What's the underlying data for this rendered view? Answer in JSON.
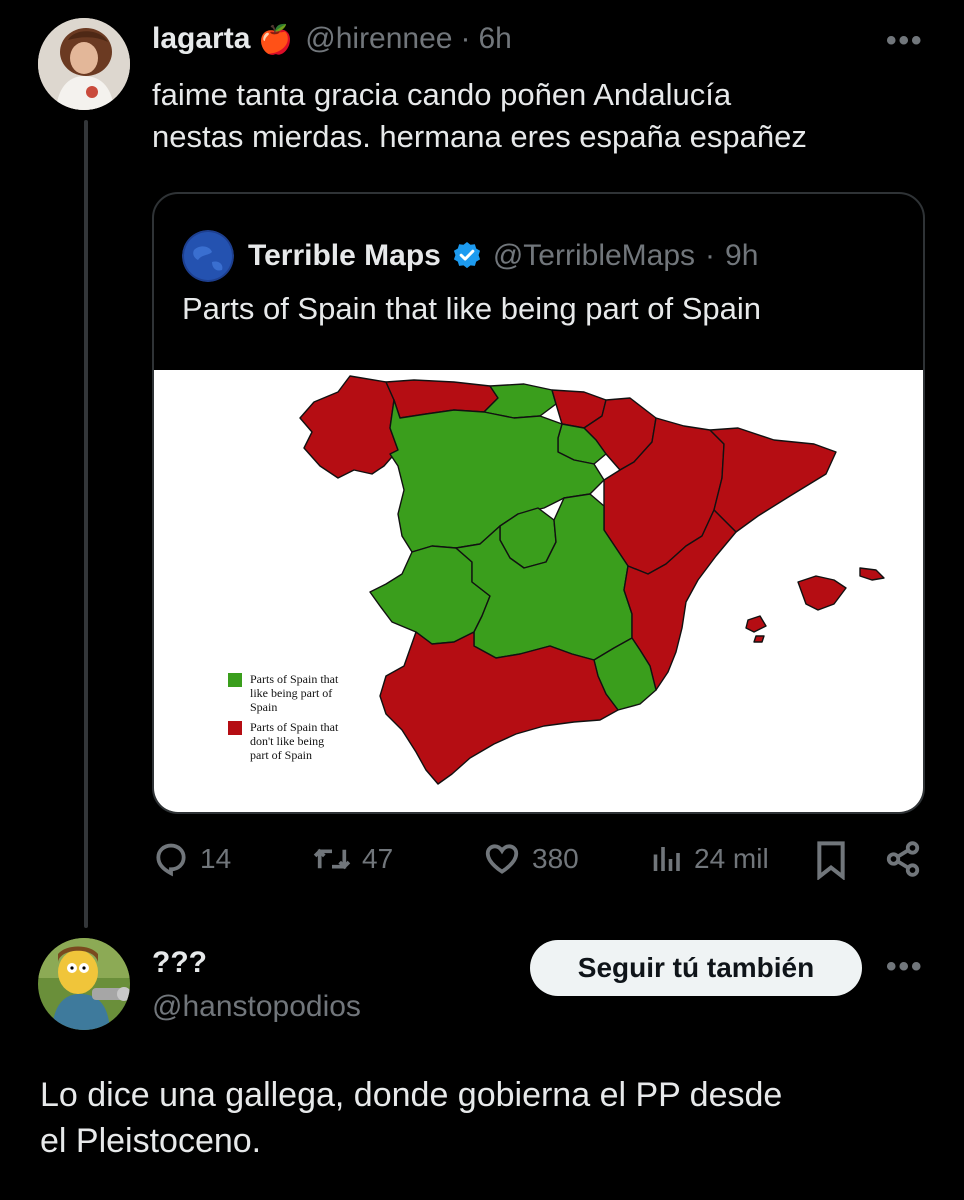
{
  "tweet": {
    "display_name": "lagarta",
    "name_emoji": "🍎",
    "handle": "@hirennee",
    "time": "6h",
    "text_line1": "faime tanta gracia cando poñen Andalucía",
    "text_line2": "nestas mierdas. hermana eres españa españez",
    "more_label": "•••"
  },
  "quote": {
    "display_name": "Terrible Maps",
    "verified": true,
    "handle": "@TerribleMaps",
    "time": "9h",
    "text": "Parts of Spain that like being part of Spain",
    "map": {
      "legend": [
        {
          "color": "#3a9e1c",
          "label_line1": "Parts of Spain that",
          "label_line2": "like being part of",
          "label_line3": "Spain"
        },
        {
          "color": "#b50d13",
          "label_line1": "Parts of Spain that",
          "label_line2": "don't like being",
          "label_line3": "part of Spain"
        }
      ]
    }
  },
  "actions": {
    "replies": "14",
    "retweets": "47",
    "likes": "380",
    "views": "24 mil"
  },
  "reply": {
    "display_name": "???",
    "handle": "@hanstopodios",
    "follow_label": "Seguir tú también",
    "more_label": "•••",
    "text_line1": "Lo dice una gallega, donde gobierna el PP desde",
    "text_line2": "el Pleistoceno."
  },
  "colors": {
    "background": "#000000",
    "text": "#e7e9ea",
    "muted": "#71767b",
    "verified": "#1d9bf0",
    "map_green": "#3a9e1c",
    "map_red": "#b50d13"
  }
}
